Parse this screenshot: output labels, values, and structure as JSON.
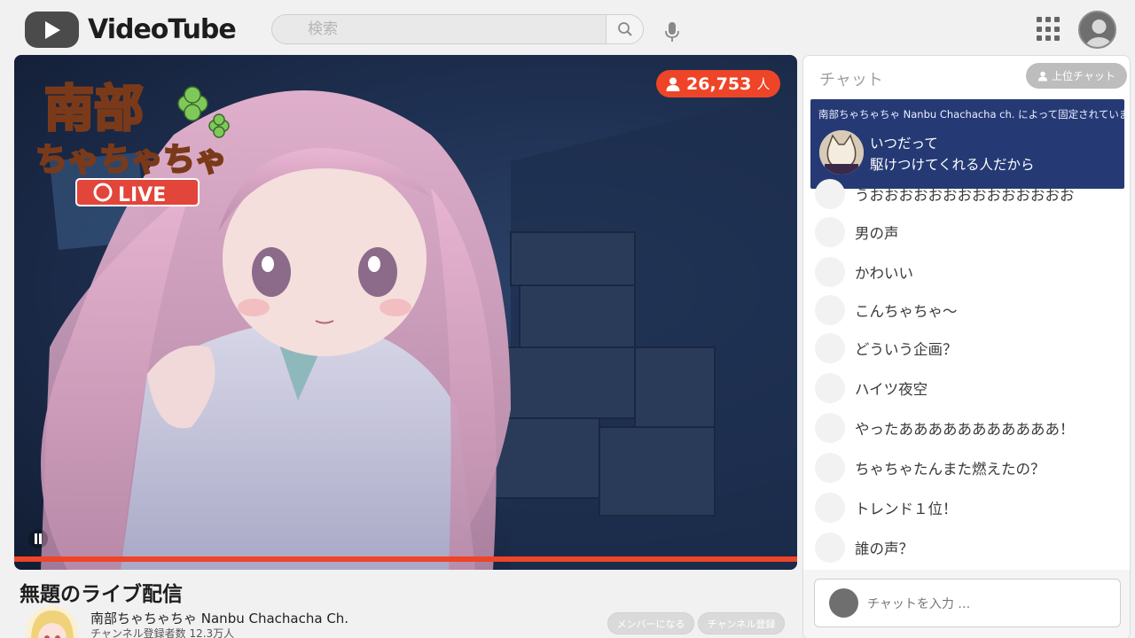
{
  "header": {
    "brand": "VideoTube",
    "search_placeholder": "検索"
  },
  "video": {
    "viewers": "26,753",
    "viewers_suffix": "人",
    "logo_line1": "南部",
    "logo_line2": "ちゃちゃちゃ",
    "live_label": "LIVE",
    "progress_percent": 100,
    "accent": "#ee4428"
  },
  "info": {
    "title": "無題のライブ配信",
    "channel_name": "南部ちゃちゃちゃ Nanbu Chachacha Ch.",
    "subscribers": "チャンネル登録者数 12.3万人",
    "member_button": "メンバーになる",
    "subscribe_button": "チャンネル登録"
  },
  "chat": {
    "title": "チャット",
    "top_chat_button": "上位チャット",
    "pinned_by": "南部ちゃちゃちゃ Nanbu Chachacha ch. によって固定されています",
    "pinned_line1": "いつだって",
    "pinned_line2": "駆けつけてくれる人だから",
    "messages": [
      "うおおおおおおおおおおおおおお",
      "男の声",
      "かわいい",
      "こんちゃちゃ〜",
      "どういう企画？",
      "ハイツ夜空",
      "やったあああああああああああ！",
      "ちゃちゃたんまた燃えたの？",
      "トレンド１位！",
      "誰の声？"
    ],
    "input_placeholder": "チャットを入力 …",
    "pinned_color": "#253a75"
  }
}
